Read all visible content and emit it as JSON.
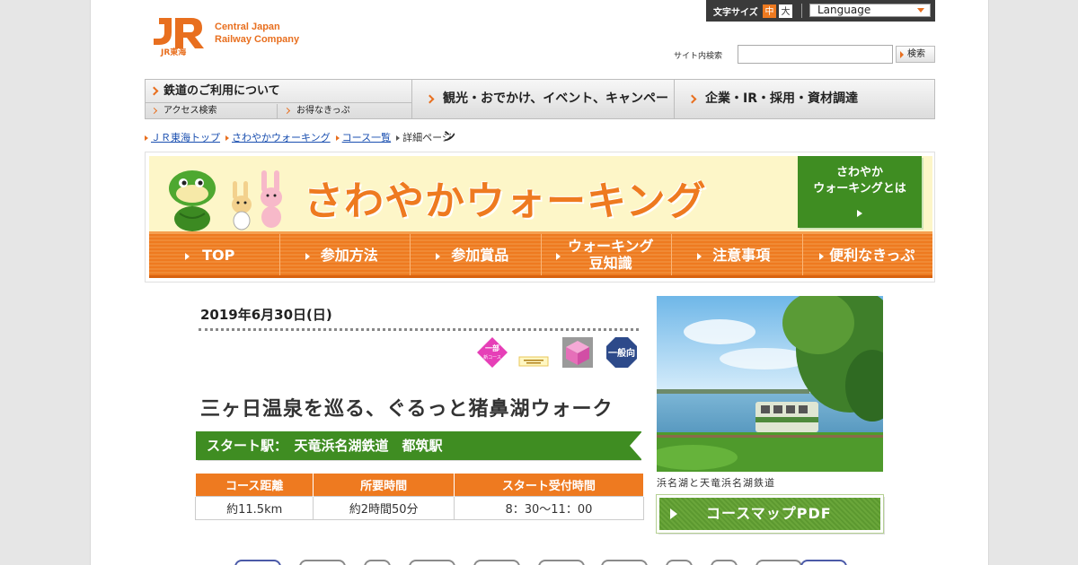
{
  "header": {
    "logo_mark": "JR",
    "logo_sub": "JR東海",
    "company_line1": "Central Japan",
    "company_line2": "Railway Company",
    "font_size_label": "文字サイズ",
    "font_size_medium": "中",
    "font_size_large": "大",
    "language": "Language",
    "search_label": "サイト内検索",
    "search_value": "",
    "search_button": "検索"
  },
  "gnav": {
    "rail": "鉄道のご利用について",
    "access": "アクセス検索",
    "tickets": "お得なきっぷ",
    "tourism": "観光・おでかけ、イベント、キャンペーン",
    "corporate": "企業・IR・採用・資材調達"
  },
  "breadcrumb": [
    "ＪＲ東海トップ",
    "さわやかウォーキング",
    "コース一覧",
    "詳細ページ"
  ],
  "banner": {
    "title": "さわやかウォーキング",
    "what_is_line1": "さわやか",
    "what_is_line2": "ウォーキングとは",
    "nav": [
      "TOP",
      "参加方法",
      "参加賞品",
      "ウォーキング\n豆知識",
      "注意事項",
      "便利なきっぷ"
    ]
  },
  "course": {
    "date": "2019年6月30日(日)",
    "badges": {
      "partial_new_line1": "一部",
      "partial_new_line2": "新コース",
      "general": "一般向"
    },
    "title": "三ヶ日温泉を巡る、ぐるっと猪鼻湖ウォーク",
    "start_station": "スタート駅：　天竜浜名湖鉄道　都筑駅",
    "table_headers": [
      "コース距離",
      "所要時間",
      "スタート受付時間"
    ],
    "table_values": [
      "約11.5km",
      "約2時間50分",
      "8：30～11：00"
    ],
    "photo_caption": "浜名湖と天竜浜名湖鉄道",
    "pdf_button": "コースマップPDF"
  },
  "colors": {
    "brand_orange": "#ee7a20",
    "green": "#3f8d22",
    "banner_bg": "#fdf6c8"
  }
}
